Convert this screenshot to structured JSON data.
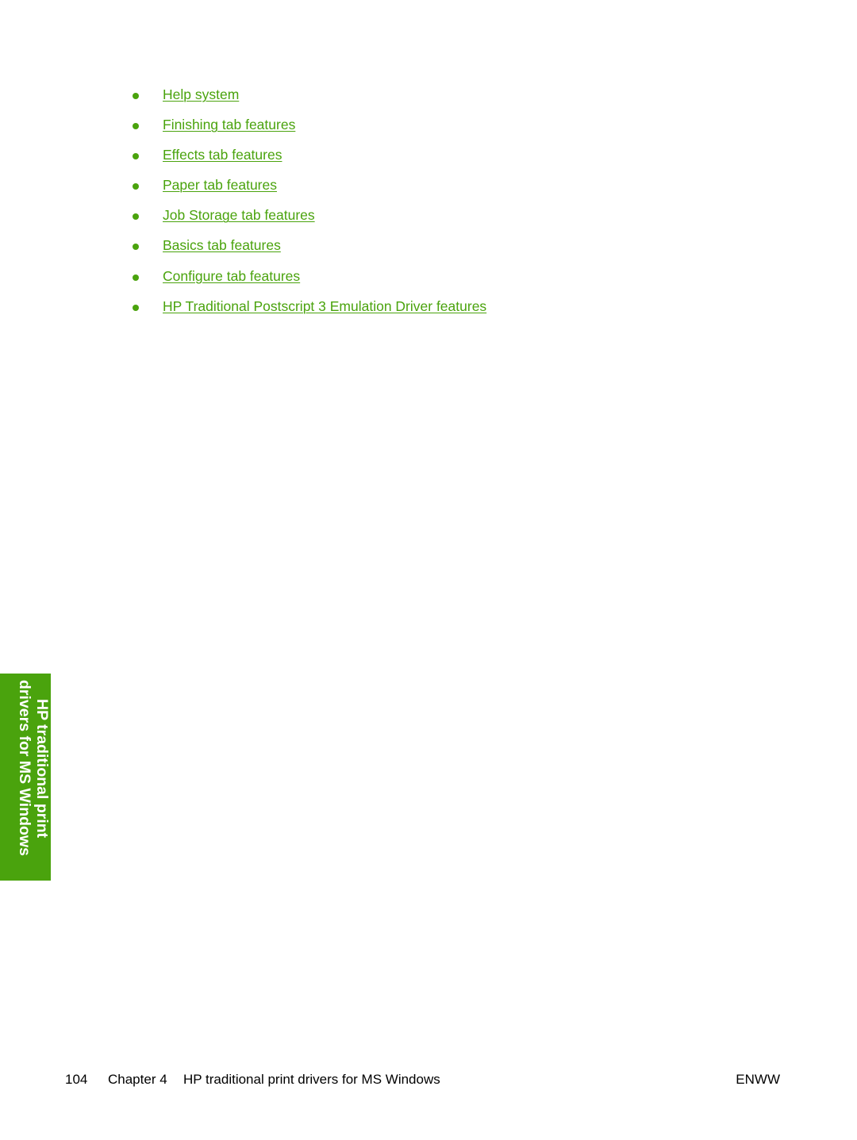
{
  "links": [
    {
      "label": "Help system"
    },
    {
      "label": "Finishing tab features"
    },
    {
      "label": "Effects tab features"
    },
    {
      "label": "Paper tab features"
    },
    {
      "label": "Job Storage tab features"
    },
    {
      "label": "Basics tab features"
    },
    {
      "label": "Configure tab features"
    },
    {
      "label": "HP Traditional Postscript 3 Emulation Driver features"
    }
  ],
  "side_tab": {
    "line1": "HP traditional print",
    "line2": "drivers for MS Windows"
  },
  "footer": {
    "page_number": "104",
    "chapter": "Chapter 4",
    "chapter_title": "HP traditional print drivers for MS Windows",
    "doc_code": "ENWW"
  },
  "colors": {
    "accent": "#4aa30d",
    "text": "#000000"
  }
}
